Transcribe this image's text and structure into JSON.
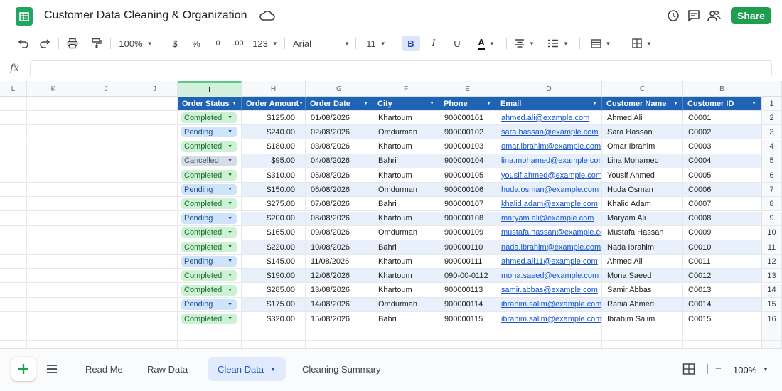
{
  "header": {
    "title": "Customer Data Cleaning & Organization",
    "share_label": "Share",
    "icons": [
      "sheets-logo-icon",
      "cloud-saved-icon",
      "history-icon",
      "comment-icon",
      "people-icon"
    ]
  },
  "toolbar": {
    "zoom": "100%",
    "currency": "$",
    "percent": "%",
    "decrease_decimal": ".0",
    "increase_decimal": ".00",
    "number_format": "123",
    "font": "Arial",
    "font_size": "11",
    "bold": "B",
    "italic": "I",
    "underline": "U",
    "text_color": "A"
  },
  "formula_bar": {
    "fx": "fx",
    "value": ""
  },
  "columns": [
    "L",
    "K",
    "J",
    "J",
    "I",
    "H",
    "G",
    "F",
    "E",
    "D",
    "C",
    "B"
  ],
  "headers": [
    "Order Status",
    "Order Amount",
    "Order Date",
    "City",
    "Phone",
    "Email",
    "Customer Name",
    "Customer ID"
  ],
  "rows": [
    {
      "n": "2",
      "status": "Completed",
      "amount": "$125.00",
      "date": "01/08/2026",
      "city": "Khartoum",
      "phone": "900000101",
      "email": "ahmed.ali@example.com",
      "name": "Ahmed Ali",
      "id": "C0001"
    },
    {
      "n": "3",
      "status": "Pending",
      "amount": "$240.00",
      "date": "02/08/2026",
      "city": "Omdurman",
      "phone": "900000102",
      "email": "sara.hassan@example.com",
      "name": "Sara Hassan",
      "id": "C0002"
    },
    {
      "n": "4",
      "status": "Completed",
      "amount": "$180.00",
      "date": "03/08/2026",
      "city": "Khartoum",
      "phone": "900000103",
      "email": "omar.ibrahim@example.com",
      "name": "Omar Ibrahim",
      "id": "C0003"
    },
    {
      "n": "5",
      "status": "Cancelled",
      "amount": "$95.00",
      "date": "04/08/2026",
      "city": "Bahri",
      "phone": "900000104",
      "email": "lina.mohamed@example.com",
      "name": "Lina Mohamed",
      "id": "C0004"
    },
    {
      "n": "6",
      "status": "Completed",
      "amount": "$310.00",
      "date": "05/08/2026",
      "city": "Khartoum",
      "phone": "900000105",
      "email": "yousif.ahmed@example.com",
      "name": "Yousif Ahmed",
      "id": "C0005"
    },
    {
      "n": "7",
      "status": "Pending",
      "amount": "$150.00",
      "date": "06/08/2026",
      "city": "Omdurman",
      "phone": "900000106",
      "email": "huda.osman@example.com",
      "name": "Huda Osman",
      "id": "C0006"
    },
    {
      "n": "8",
      "status": "Completed",
      "amount": "$275.00",
      "date": "07/08/2026",
      "city": "Bahri",
      "phone": "900000107",
      "email": "khalid.adam@example.com",
      "name": "Khalid Adam",
      "id": "C0007"
    },
    {
      "n": "9",
      "status": "Pending",
      "amount": "$200.00",
      "date": "08/08/2026",
      "city": "Khartoum",
      "phone": "900000108",
      "email": "maryam.ali@example.com",
      "name": "Maryam Ali",
      "id": "C0008"
    },
    {
      "n": "10",
      "status": "Completed",
      "amount": "$165.00",
      "date": "09/08/2026",
      "city": "Omdurman",
      "phone": "900000109",
      "email": "mustafa.hassan@example.com",
      "name": "Mustafa Hassan",
      "id": "C0009"
    },
    {
      "n": "11",
      "status": "Completed",
      "amount": "$220.00",
      "date": "10/08/2026",
      "city": "Bahri",
      "phone": "900000110",
      "email": "nada.ibrahim@example.com",
      "name": "Nada Ibrahim",
      "id": "C0010"
    },
    {
      "n": "12",
      "status": "Pending",
      "amount": "$145.00",
      "date": "11/08/2026",
      "city": "Khartoum",
      "phone": "900000111",
      "email": "ahmed.ali11@example.com",
      "name": "Ahmed Ali",
      "id": "C0011"
    },
    {
      "n": "13",
      "status": "Completed",
      "amount": "$190.00",
      "date": "12/08/2026",
      "city": "Khartoum",
      "phone": "090-00-0112",
      "email": "mona.saeed@example.com",
      "name": "Mona Saeed",
      "id": "C0012"
    },
    {
      "n": "14",
      "status": "Completed",
      "amount": "$285.00",
      "date": "13/08/2026",
      "city": "Khartoum",
      "phone": "900000113",
      "email": "samir.abbas@example.com",
      "name": "Samir Abbas",
      "id": "C0013"
    },
    {
      "n": "15",
      "status": "Pending",
      "amount": "$175.00",
      "date": "14/08/2026",
      "city": "Omdurman",
      "phone": "900000114",
      "email": "ibrahim.salim@example.com",
      "name": "Rania Ahmed",
      "id": "C0014"
    },
    {
      "n": "16",
      "status": "Completed",
      "amount": "$320.00",
      "date": "15/08/2026",
      "city": "Bahri",
      "phone": "900000115",
      "email": "ibrahim.salim@example.com",
      "name": "Ibrahim Salim",
      "id": "C0015"
    }
  ],
  "header_row_number": "1",
  "sheets": {
    "tabs": [
      "Read Me",
      "Raw Data",
      "Clean Data",
      "Cleaning Summary"
    ],
    "active": "Clean Data",
    "zoom": "100%"
  },
  "colors": {
    "header_fill": "#1e63b4",
    "completed": "#cdf1d3",
    "pending": "#cfe3fb",
    "cancelled": "#d5dde6",
    "share": "#1e9e4f"
  }
}
